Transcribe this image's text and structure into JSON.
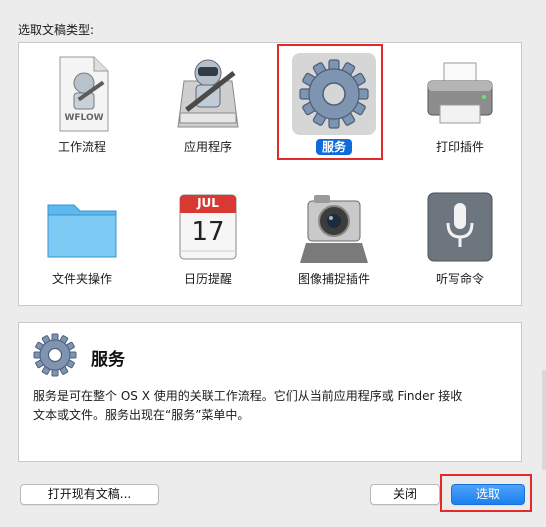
{
  "dialog": {
    "title": "选取文稿类型:"
  },
  "tiles": [
    {
      "label": "工作流程",
      "icon": "workflow-file-icon",
      "file_badge": "WFLOW"
    },
    {
      "label": "应用程序",
      "icon": "automator-robot-icon"
    },
    {
      "label": "服务",
      "icon": "gear-icon",
      "selected": true
    },
    {
      "label": "打印插件",
      "icon": "printer-icon"
    },
    {
      "label": "文件夹操作",
      "icon": "folder-icon"
    },
    {
      "label": "日历提醒",
      "icon": "calendar-icon",
      "cal_month": "JUL",
      "cal_day": "17"
    },
    {
      "label": "图像捕捉插件",
      "icon": "camera-icon"
    },
    {
      "label": "听写命令",
      "icon": "microphone-icon"
    }
  ],
  "description": {
    "icon": "gear-icon",
    "title": "服务",
    "line1": "服务是可在整个 OS X 使用的关联工作流程。它们从当前应用程序或 Finder 接收",
    "line2": "文本或文件。服务出现在“服务”菜单中。"
  },
  "buttons": {
    "open_existing": "打开现有文稿...",
    "close": "关闭",
    "choose": "选取"
  },
  "colors": {
    "selection_blue": "#0f6bdc",
    "annotation_red": "#e22a2a",
    "primary_button": "#1b7ff0"
  }
}
